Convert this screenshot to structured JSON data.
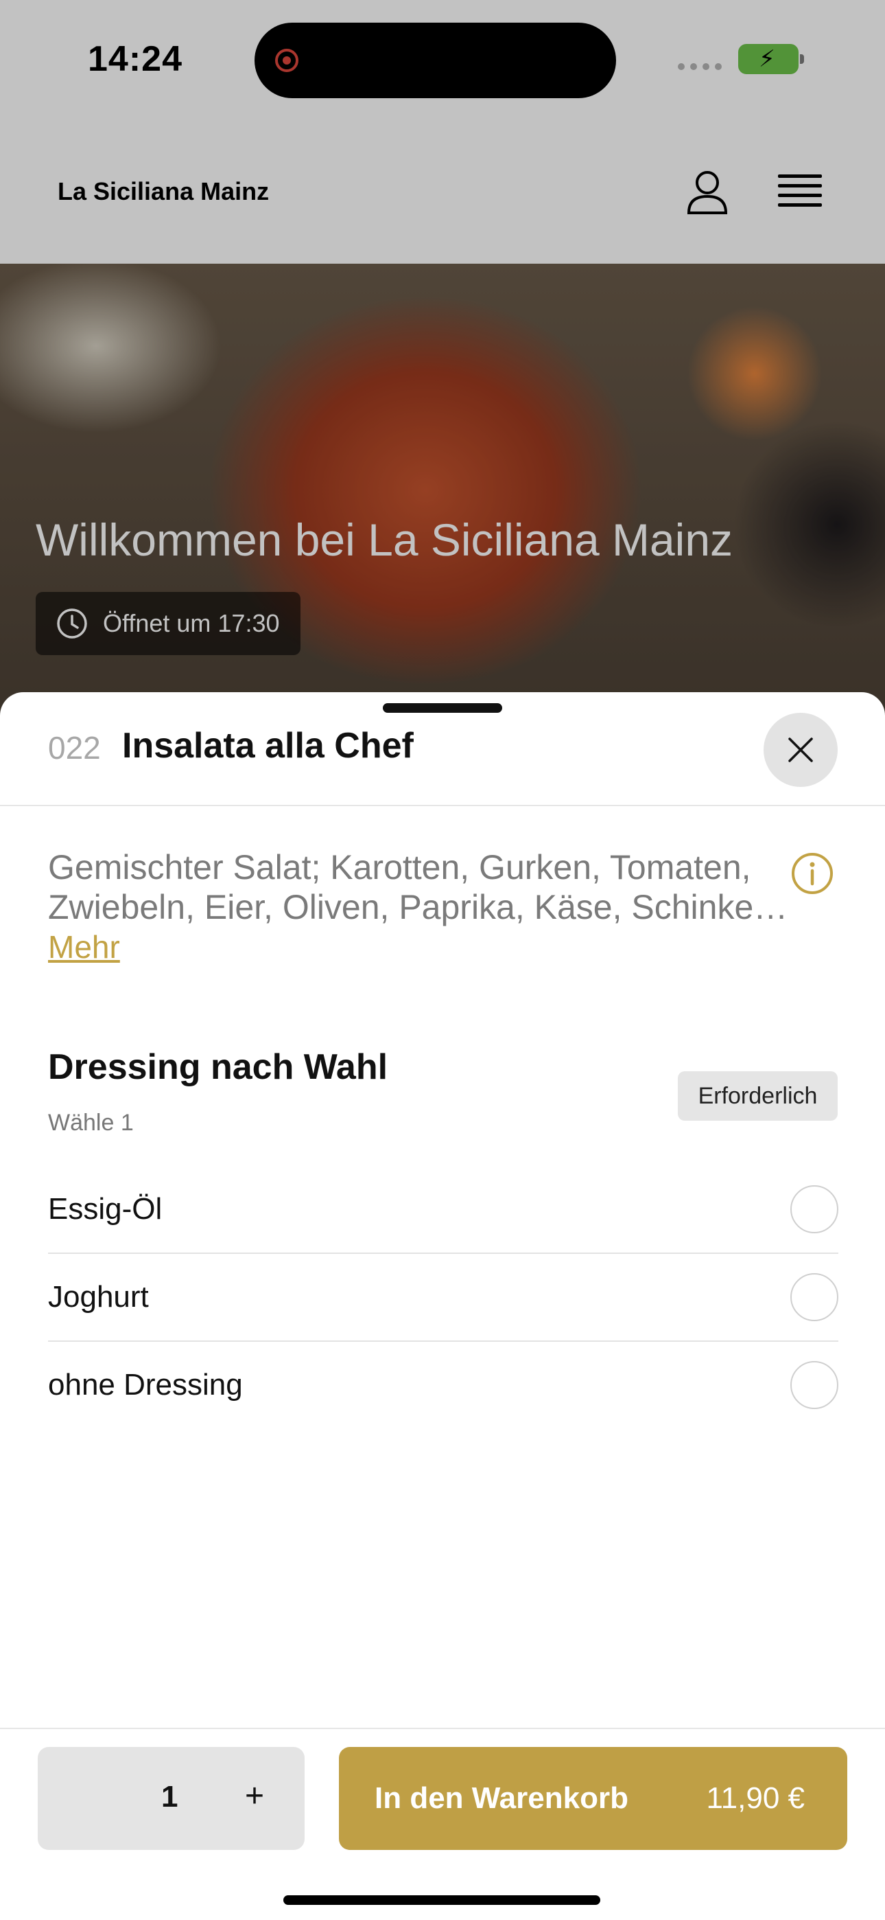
{
  "status_bar": {
    "time": "14:24"
  },
  "header": {
    "brand": "La Siciliana Mainz"
  },
  "hero": {
    "title": "Willkommen bei La Siciliana Mainz",
    "opening": "Öffnet um 17:30"
  },
  "item": {
    "number": "022",
    "title": "Insalata alla Chef",
    "description": "Gemischter Salat; Karotten, Gurken, Tomaten, Zwiebeln, Eier, Oliven, Paprika, Käse, Schinke…",
    "more_label": "Mehr"
  },
  "option_group": {
    "title": "Dressing nach Wahl",
    "subtitle": "Wähle 1",
    "badge": "Erforderlich",
    "options": [
      {
        "label": "Essig-Öl",
        "selected": false
      },
      {
        "label": "Joghurt",
        "selected": false
      },
      {
        "label": "ohne Dressing",
        "selected": false
      }
    ]
  },
  "footer": {
    "quantity": "1",
    "plus_label": "+",
    "cart_label": "In den Warenkorb",
    "price": "11,90 €"
  },
  "colors": {
    "accent": "#bf9f45",
    "battery": "#6cc24a",
    "record": "#e0473d"
  }
}
